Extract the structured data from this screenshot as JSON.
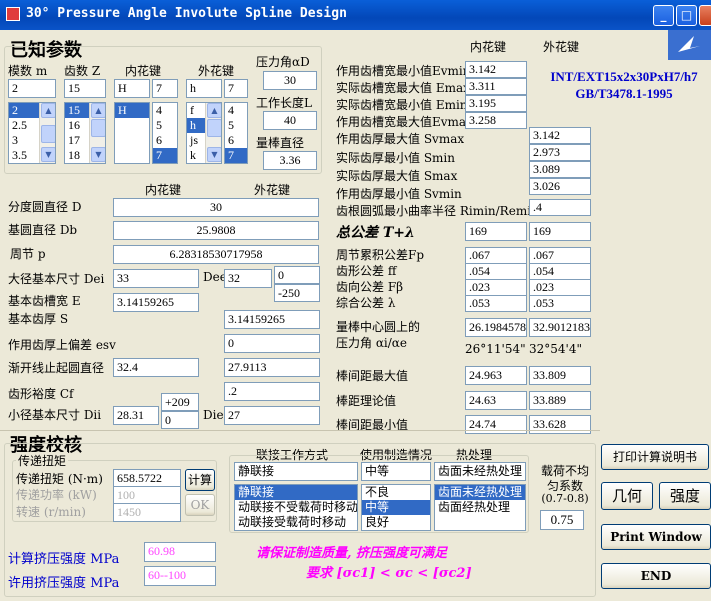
{
  "window": {
    "title": "30° Pressure Angle Involute Spline Design",
    "min": "_",
    "max": "□",
    "close": "×"
  },
  "known": {
    "section_title": "已知参数",
    "module_label": "模数 m",
    "teeth_label": "齿数 Z",
    "inner_label": "内花键",
    "outer_label": "外花键",
    "module_value": "2",
    "teeth_value": "15",
    "inner_fit": "H",
    "inner_grade": "7",
    "outer_fit": "h",
    "outer_grade": "7",
    "module_list": [
      "2",
      "2.5",
      "3",
      "3.5"
    ],
    "teeth_list": [
      "15",
      "16",
      "17",
      "18"
    ],
    "inner_fit_list": [
      "H"
    ],
    "inner_grade_list": [
      "4",
      "5",
      "6",
      "7"
    ],
    "outer_fit_list": [
      "f",
      "h",
      "js",
      "k"
    ],
    "outer_grade_list": [
      "4",
      "5",
      "6",
      "7"
    ],
    "pressure_angle_label": "压力角αD",
    "pressure_angle": "30",
    "work_length_label": "工作长度L",
    "work_length": "40",
    "rod_diameter_label": "量棒直径",
    "rod_diameter": "3.36"
  },
  "geom": {
    "inner_hdr": "内花键",
    "outer_hdr": "外花键",
    "pitch_diameter_label": "分度圆直径 D",
    "pitch_diameter": "30",
    "base_diameter_label": "基圆直径  Db",
    "base_diameter": "25.9808",
    "pitch_label": "周节    p",
    "pitch": "6.28318530717958",
    "major_label": "大径基本尺寸 Dei",
    "major_inner": "33",
    "dee_label": "Dee",
    "major_outer": "32",
    "dee_upper": "0",
    "dee_lower": "-250",
    "space_width_label": "基本齿槽宽 E",
    "space_width": "3.14159265",
    "tooth_thickness_label": "基本齿厚 S",
    "tooth_thickness": "3.14159265",
    "esv_label": "作用齿厚上偏差 esv",
    "esv": "0",
    "form_dia_label": "渐开线止起圆直径",
    "form_inner": "32.4",
    "form_outer": "27.9113",
    "clearance_label": "齿形裕度 Cf",
    "clearance": ".2",
    "minor_label": "小径基本尺寸 Dii",
    "minor_inner": "28.31",
    "dii_upper": "+209",
    "dii_lower": "0",
    "die_label": "Die",
    "minor_outer": "27"
  },
  "results": {
    "inner_hdr": "内花键",
    "outer_hdr": "外花键",
    "spec_line1": "INT/EXT15x2x30PxH7/h7",
    "spec_line2": "GB/T3478.1-1995",
    "evmin_label": "作用齿槽宽最小值Evmin",
    "evmin": "3.142",
    "emax_label": "实际齿槽宽最大值 Emax",
    "emax": "3.311",
    "emin_label": "实际齿槽宽最小值 Emin",
    "emin": "3.195",
    "evmax_label": "作用齿槽宽最大值Evmax",
    "evmax": "3.258",
    "svmax_label": "作用齿厚最大值 Svmax",
    "svmax": "3.142",
    "smin_label": "实际齿厚最小值 Smin",
    "smin": "2.973",
    "smax_label": "实际齿厚最大值 Smax",
    "smax": "3.089",
    "svmin_label": "作用齿厚最小值 Svmin",
    "svmin": "3.026",
    "rmin_label": "齿根圆弧最小曲率半径 Rimin/Remin",
    "rmin": ".4",
    "total_label": "总公差  T+λ",
    "total_inner": "169",
    "total_outer": "169",
    "fp_label": "周节累积公差Fp",
    "fp_inner": ".067",
    "fp_outer": ".067",
    "ff_label": "齿形公差   ff",
    "ff_inner": ".054",
    "ff_outer": ".054",
    "fb_label": "齿向公差   Fβ",
    "fb_inner": ".023",
    "fb_outer": ".023",
    "lam_label": "综合公差   λ",
    "lam_inner": ".053",
    "lam_outer": ".053",
    "rod_center_label1": "量棒中心圆上的",
    "rod_center_label2": "压力角 αi/αe",
    "rod_center_inner": "26.1984578",
    "rod_center_outer": "32.9012183",
    "rod_angle_inner": "26°11'54\"",
    "rod_angle_outer": "32°54'4\"",
    "span_max_label": "棒间距最大值",
    "span_max_inner": "24.963",
    "span_max_outer": "33.809",
    "span_nom_label": "棒距理论值",
    "span_nom_inner": "24.63",
    "span_nom_outer": "33.889",
    "span_min_label": "棒间距最小值",
    "span_min_inner": "24.74",
    "span_min_outer": "33.628"
  },
  "strength": {
    "section_title": "强度校核",
    "torque_group": "传递扭矩",
    "torque_label": "传递扭矩 (N·m)",
    "torque": "658.5722",
    "power_label": "传递功率 (kW)",
    "power": "100",
    "speed_label": "转速  (r/min)",
    "speed": "1450",
    "calc_button": "计算",
    "ok_button": "OK",
    "link_hdr": "联接工作方式",
    "mfg_hdr": "使用制造情况",
    "heat_hdr": "热处理",
    "link_value": "静联接",
    "mfg_value": "中等",
    "heat_value": "齿面未经热处理",
    "link_list": [
      "静联接",
      "动联接不受载荷时移动",
      "动联接受载荷时移动"
    ],
    "mfg_list": [
      "不良",
      "中等",
      "良好"
    ],
    "heat_list": [
      "齿面未经热处理",
      "齿面经热处理"
    ],
    "load_label1": "载荷不均",
    "load_label2": "匀系数",
    "load_label3": "(0.7-0.8)",
    "load_value": "0.75",
    "calc_stress_label": "计算挤压强度 MPa",
    "calc_stress": "60.98",
    "allow_stress_label": "许用挤压强度 MPa",
    "allow_stress": "60--100",
    "note_line1": "请保证制造质量, 挤压强度可满足",
    "note_line2": "要求 [σc1] < σc < [σc2]"
  },
  "buttons": {
    "print_manual": "打印计算说明书",
    "geometry": "几何",
    "strength": "强度",
    "print_window": "Print Window",
    "end": "END"
  },
  "colors": {
    "title_bar": "#0347b8",
    "selection": "#316ac5",
    "spec_text": "#0000cc",
    "note_text": "#ff00ff"
  }
}
